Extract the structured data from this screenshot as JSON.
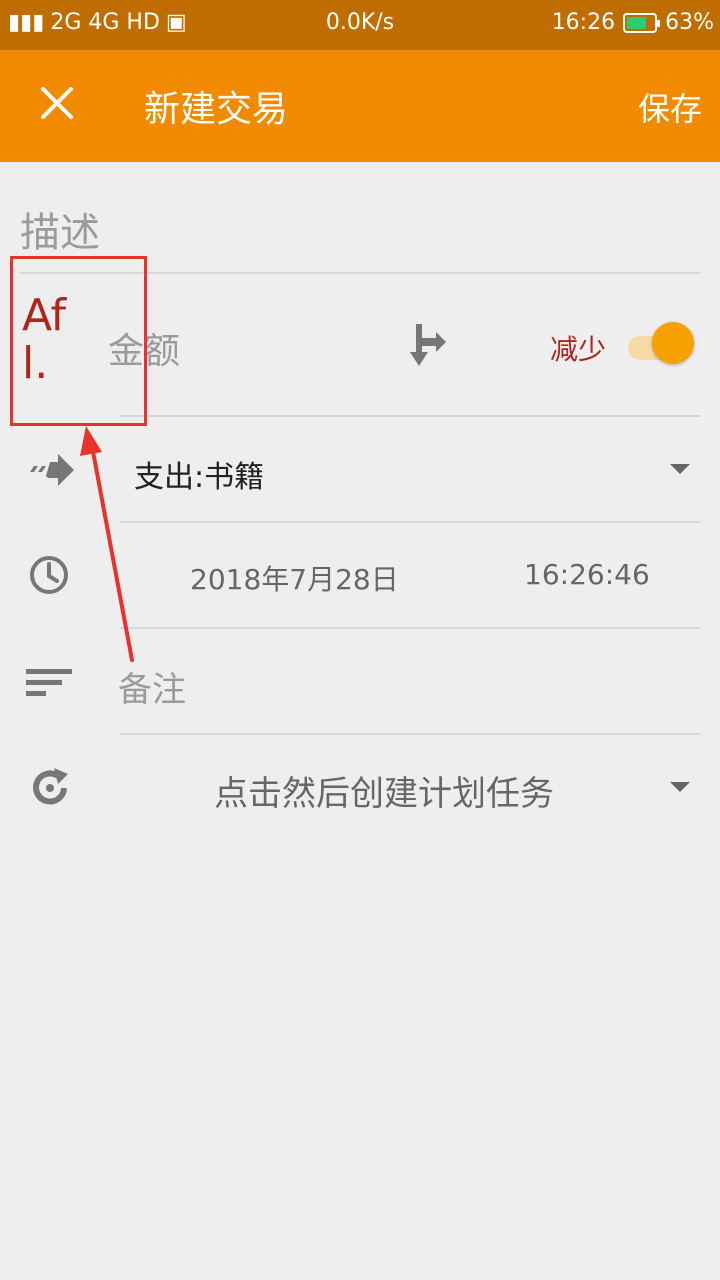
{
  "status_bar": {
    "left_text": "2G 4G HD",
    "network_speed": "0.0K/s",
    "time": "16:26",
    "battery": "63%"
  },
  "app_bar": {
    "close_icon": "close-icon",
    "title": "新建交易",
    "save_label": "保存"
  },
  "form": {
    "description_placeholder": "描述",
    "amount_placeholder": "金额",
    "transaction_type_label": "减少",
    "toggle_on": true,
    "category": "支出:书籍",
    "date": "2018年7月28日",
    "time": "16:26:46",
    "notes_placeholder": "备注",
    "schedule_placeholder": "点击然后创建计划任务"
  },
  "annotation": {
    "text_line1": "Af",
    "text_line2": "l.",
    "color": "#e8322b"
  },
  "colors": {
    "app_bar": "#f28a00",
    "status_bar": "#c06d00",
    "accent": "#f7a100",
    "reduce_text": "#b1241a"
  }
}
